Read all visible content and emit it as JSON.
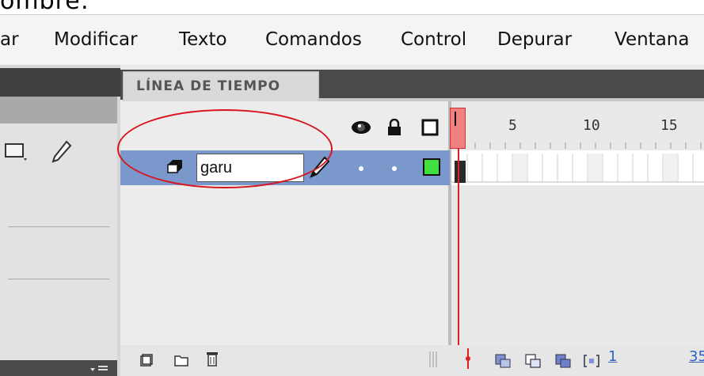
{
  "top_caption": "ombre:",
  "menu": {
    "items": [
      "ar",
      "Modificar",
      "Texto",
      "Comandos",
      "Control",
      "Depurar",
      "Ventana"
    ]
  },
  "timeline": {
    "tab_label": "LÍNEA DE TIEMPO",
    "ruler": [
      "5",
      "10",
      "15"
    ],
    "header_icons": [
      "eye-icon",
      "lock-icon",
      "outline-icon"
    ],
    "layer": {
      "name_value": "garu",
      "outline_color": "#3fe03f"
    },
    "current_frame": "1",
    "fps": "35"
  },
  "colors": {
    "annotation": "#d8141d",
    "layer_selected": "#7a98cc",
    "playhead": "#e02020"
  }
}
